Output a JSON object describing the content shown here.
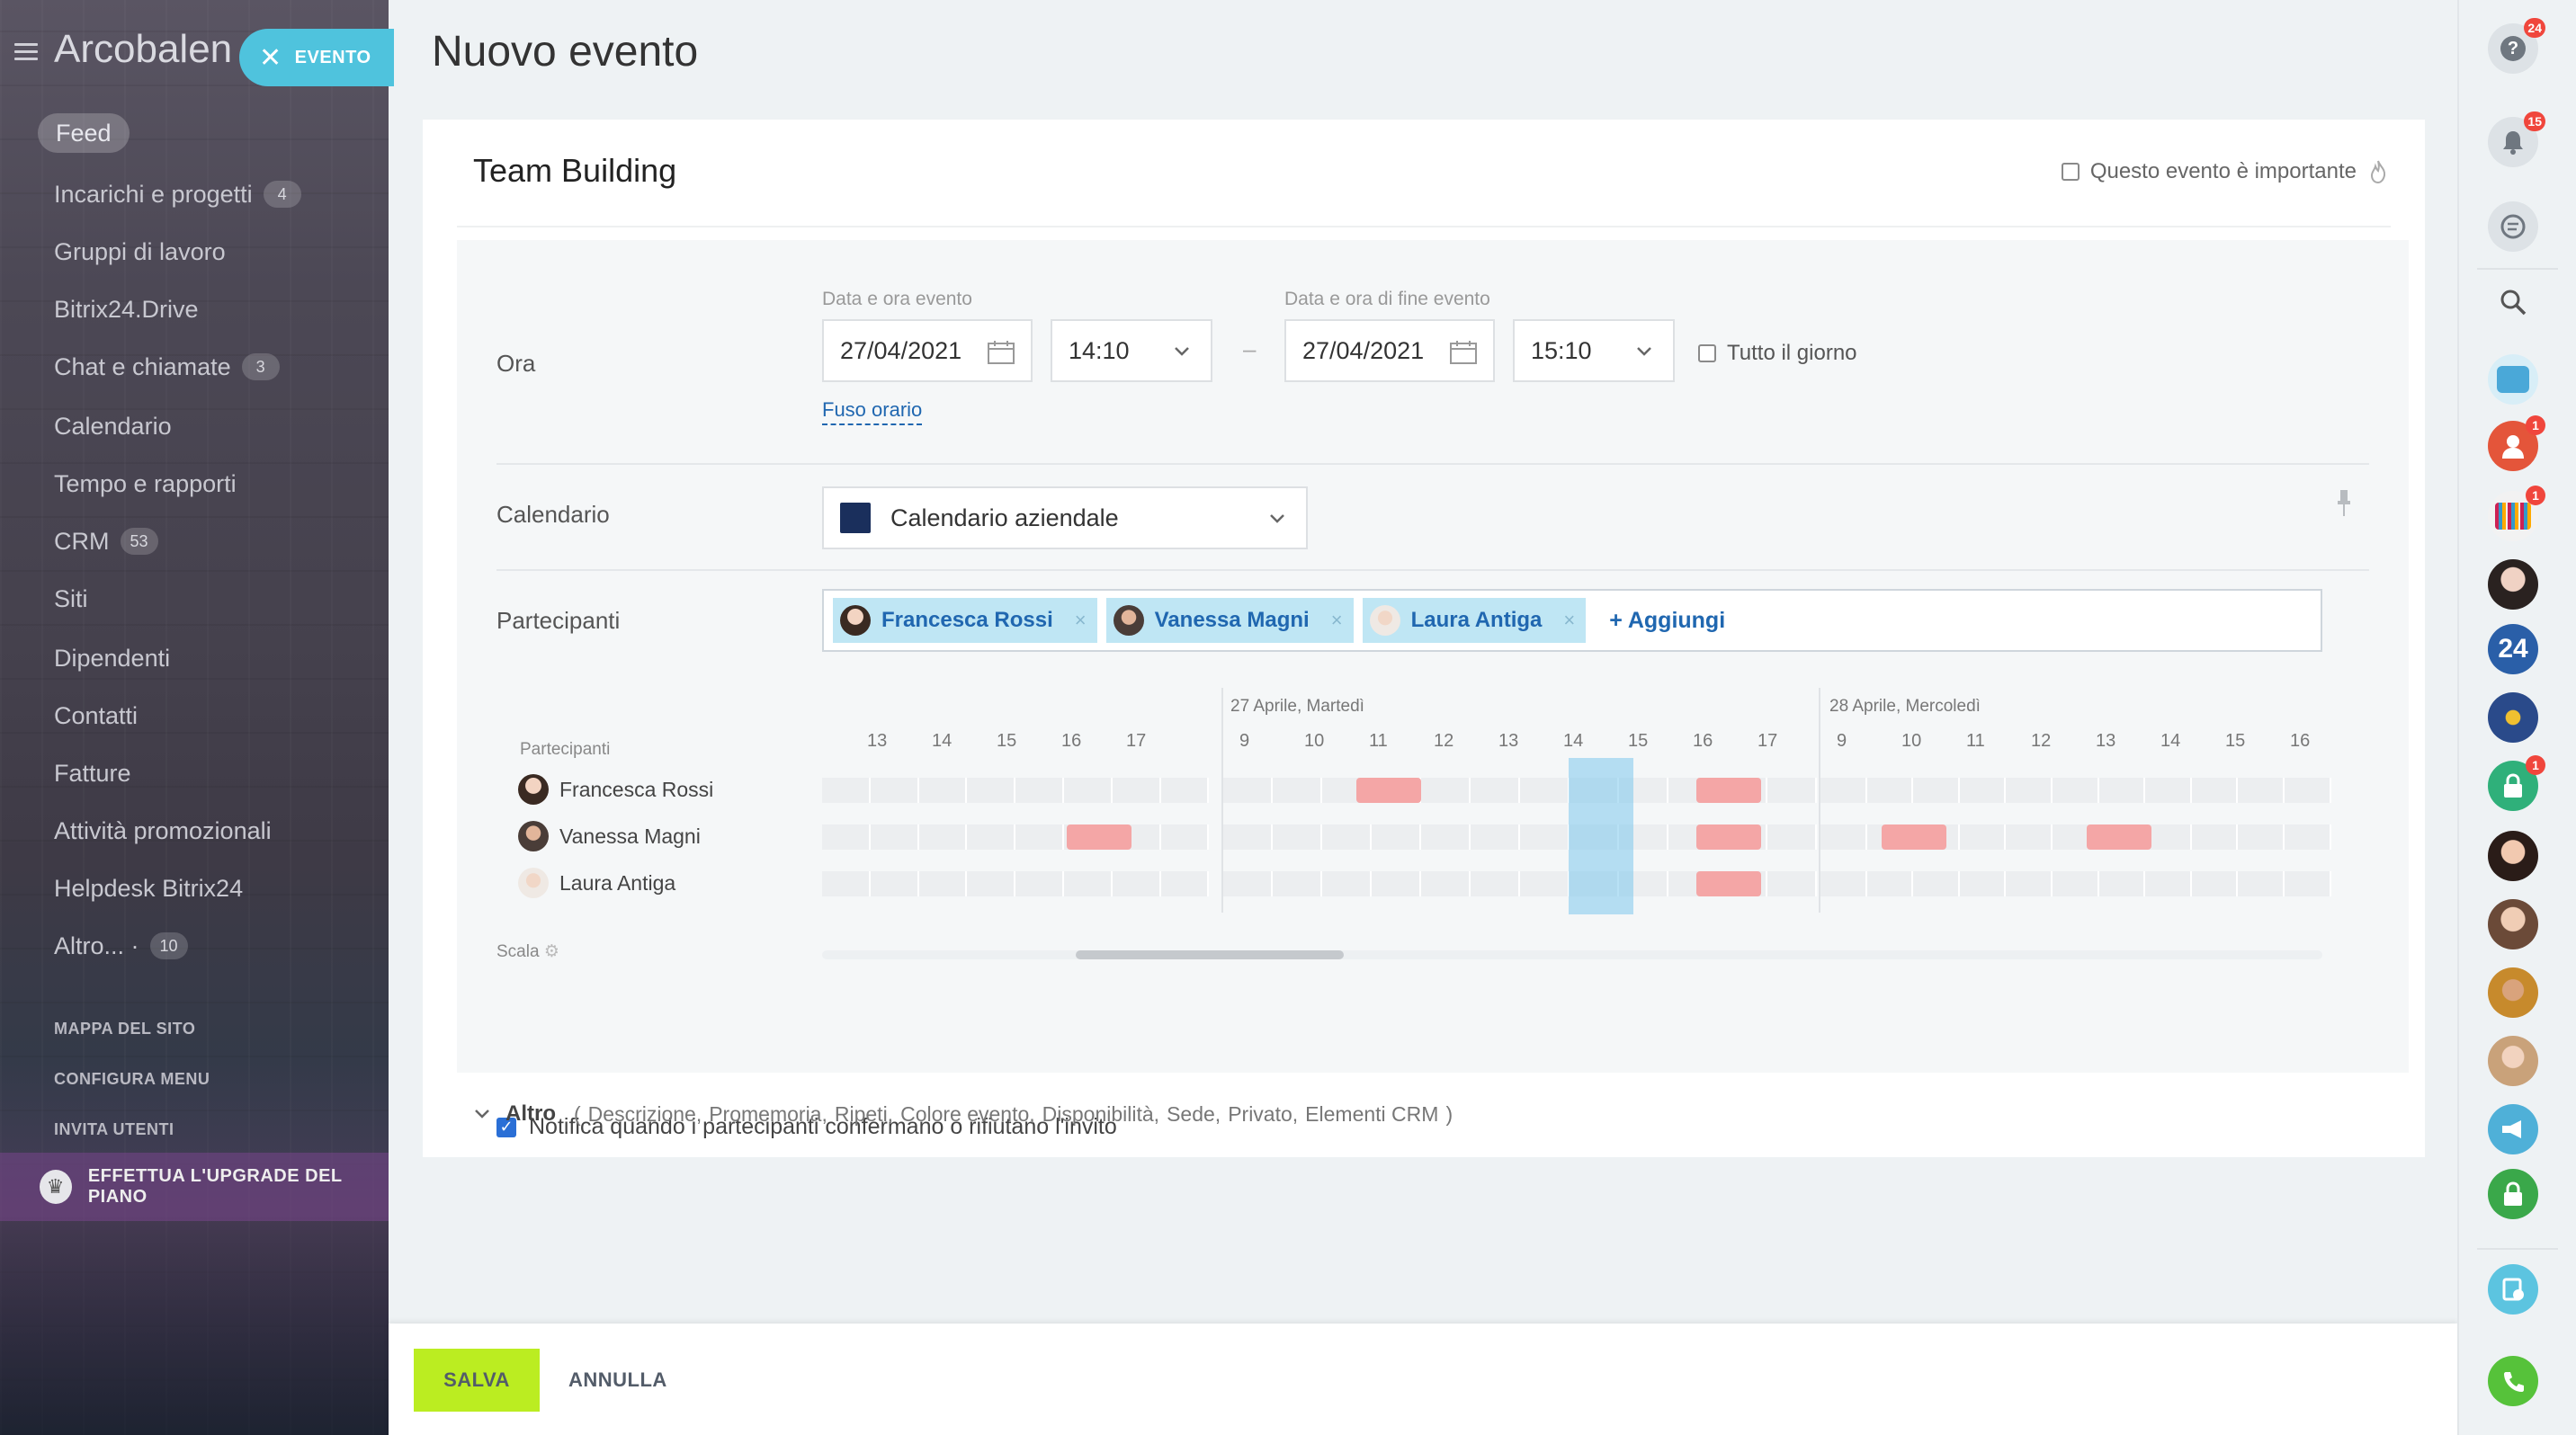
{
  "sidebar": {
    "brand": "Arcobalen",
    "event_pill_label": "EVENTO",
    "items": [
      {
        "label": "Feed",
        "badge": ""
      },
      {
        "label": "Incarichi e progetti",
        "badge": "4"
      },
      {
        "label": "Gruppi di lavoro",
        "badge": ""
      },
      {
        "label": "Bitrix24.Drive",
        "badge": ""
      },
      {
        "label": "Chat e chiamate",
        "badge": "3"
      },
      {
        "label": "Calendario",
        "badge": ""
      },
      {
        "label": "Tempo e rapporti",
        "badge": ""
      },
      {
        "label": "CRM",
        "badge": "53"
      },
      {
        "label": "Siti",
        "badge": ""
      },
      {
        "label": "Dipendenti",
        "badge": ""
      },
      {
        "label": "Contatti",
        "badge": ""
      },
      {
        "label": "Fatture",
        "badge": ""
      },
      {
        "label": "Attività promozionali",
        "badge": ""
      },
      {
        "label": "Helpdesk Bitrix24",
        "badge": ""
      },
      {
        "label": "Altro... ·",
        "badge": "10"
      }
    ],
    "site_map": "MAPPA DEL SITO",
    "configure_menu": "CONFIGURA MENU",
    "invite_users": "INVITA UTENTI",
    "upgrade": "EFFETTUA L'UPGRADE DEL PIANO"
  },
  "page": {
    "title": "Nuovo evento",
    "event_title": "Team Building",
    "important_label": "Questo evento è importante"
  },
  "time": {
    "row_label": "Ora",
    "start_label": "Data e ora evento",
    "end_label": "Data e ora di fine evento",
    "start_date": "27/04/2021",
    "start_time": "14:10",
    "dash": "–",
    "end_date": "27/04/2021",
    "end_time": "15:10",
    "all_day": "Tutto il giorno",
    "timezone": "Fuso orario"
  },
  "calendar": {
    "row_label": "Calendario",
    "value": "Calendario aziendale",
    "color": "#1a2f5c"
  },
  "participants": {
    "row_label": "Partecipanti",
    "chips": [
      {
        "name": "Francesca Rossi"
      },
      {
        "name": "Vanessa Magni"
      },
      {
        "name": "Laura Antiga"
      }
    ],
    "remove_glyph": "×",
    "add_label": "+ Aggiungi"
  },
  "planner": {
    "header": "Partecipanti",
    "day1_label": "27 Aprile, Martedì",
    "day2_label": "28 Aprile, Mercoledì",
    "scale_label": "Scala",
    "people": [
      "Francesca Rossi",
      "Vanessa Magni",
      "Laura Antiga"
    ],
    "hours_block0": [
      "13",
      "14",
      "15",
      "16",
      "17"
    ],
    "hours_block1": [
      "9",
      "10",
      "11",
      "12",
      "13",
      "14",
      "15",
      "16",
      "17"
    ],
    "hours_block2": [
      "9",
      "10",
      "11",
      "12",
      "13",
      "14",
      "15",
      "16"
    ],
    "busy_color": "#f4a6a6",
    "selection_color": "#7ec8ec"
  },
  "notify_label": "Notifica quando i partecipanti confermano o rifiutano l'invito",
  "more": {
    "label": "Altro",
    "open_paren": "(",
    "close_paren": ")",
    "options": [
      "Descrizione,",
      "Promemoria,",
      "Ripeti,",
      "Colore evento,",
      "Disponibilità,",
      "Sede,",
      "Privato,",
      "Elementi CRM"
    ]
  },
  "footer": {
    "save": "SALVA",
    "cancel": "ANNULLA"
  },
  "rightbar": {
    "help_badge": "24",
    "notif_badge": "15",
    "user_badge1": "1",
    "user_badge2": "1",
    "lock_badge": "1",
    "b24_label": "24"
  }
}
